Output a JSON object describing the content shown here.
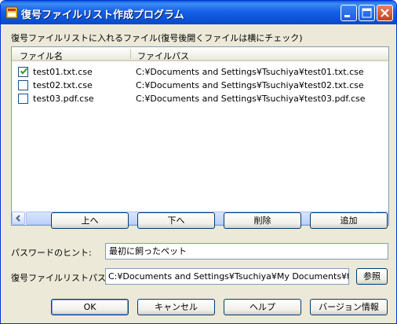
{
  "window": {
    "title": "復号ファイルリスト作成プログラム"
  },
  "list_section": {
    "label": "復号ファイルリストに入れるファイル(復号後開くファイルは横にチェック)",
    "columns": [
      "ファイル名",
      "ファイルパス"
    ],
    "rows": [
      {
        "checked": true,
        "name": "test01.txt.cse",
        "path": "C:¥Documents and Settings¥Tsuchiya¥test01.txt.cse"
      },
      {
        "checked": false,
        "name": "test02.txt.cse",
        "path": "C:¥Documents and Settings¥Tsuchiya¥test02.txt.cse"
      },
      {
        "checked": false,
        "name": "test03.pdf.cse",
        "path": "C:¥Documents and Settings¥Tsuchiya¥test03.pdf.cse"
      }
    ]
  },
  "row_buttons": {
    "up": "上へ",
    "down": "下へ",
    "delete": "削除",
    "add": "追加"
  },
  "hint": {
    "label": "パスワードのヒント:",
    "value": "最初に飼ったペット"
  },
  "list_path": {
    "label": "復号ファイルリストパス:",
    "value": "C:¥Documents and Settings¥Tsuchiya¥My Documents¥test.",
    "browse": "参照"
  },
  "footer_buttons": {
    "ok": "OK",
    "cancel": "キャンセル",
    "help": "ヘルプ",
    "version": "バージョン情報"
  },
  "colors": {
    "titlebar": "#0a5fd8",
    "window_bg": "#ece9d8",
    "check": "#21a121"
  }
}
